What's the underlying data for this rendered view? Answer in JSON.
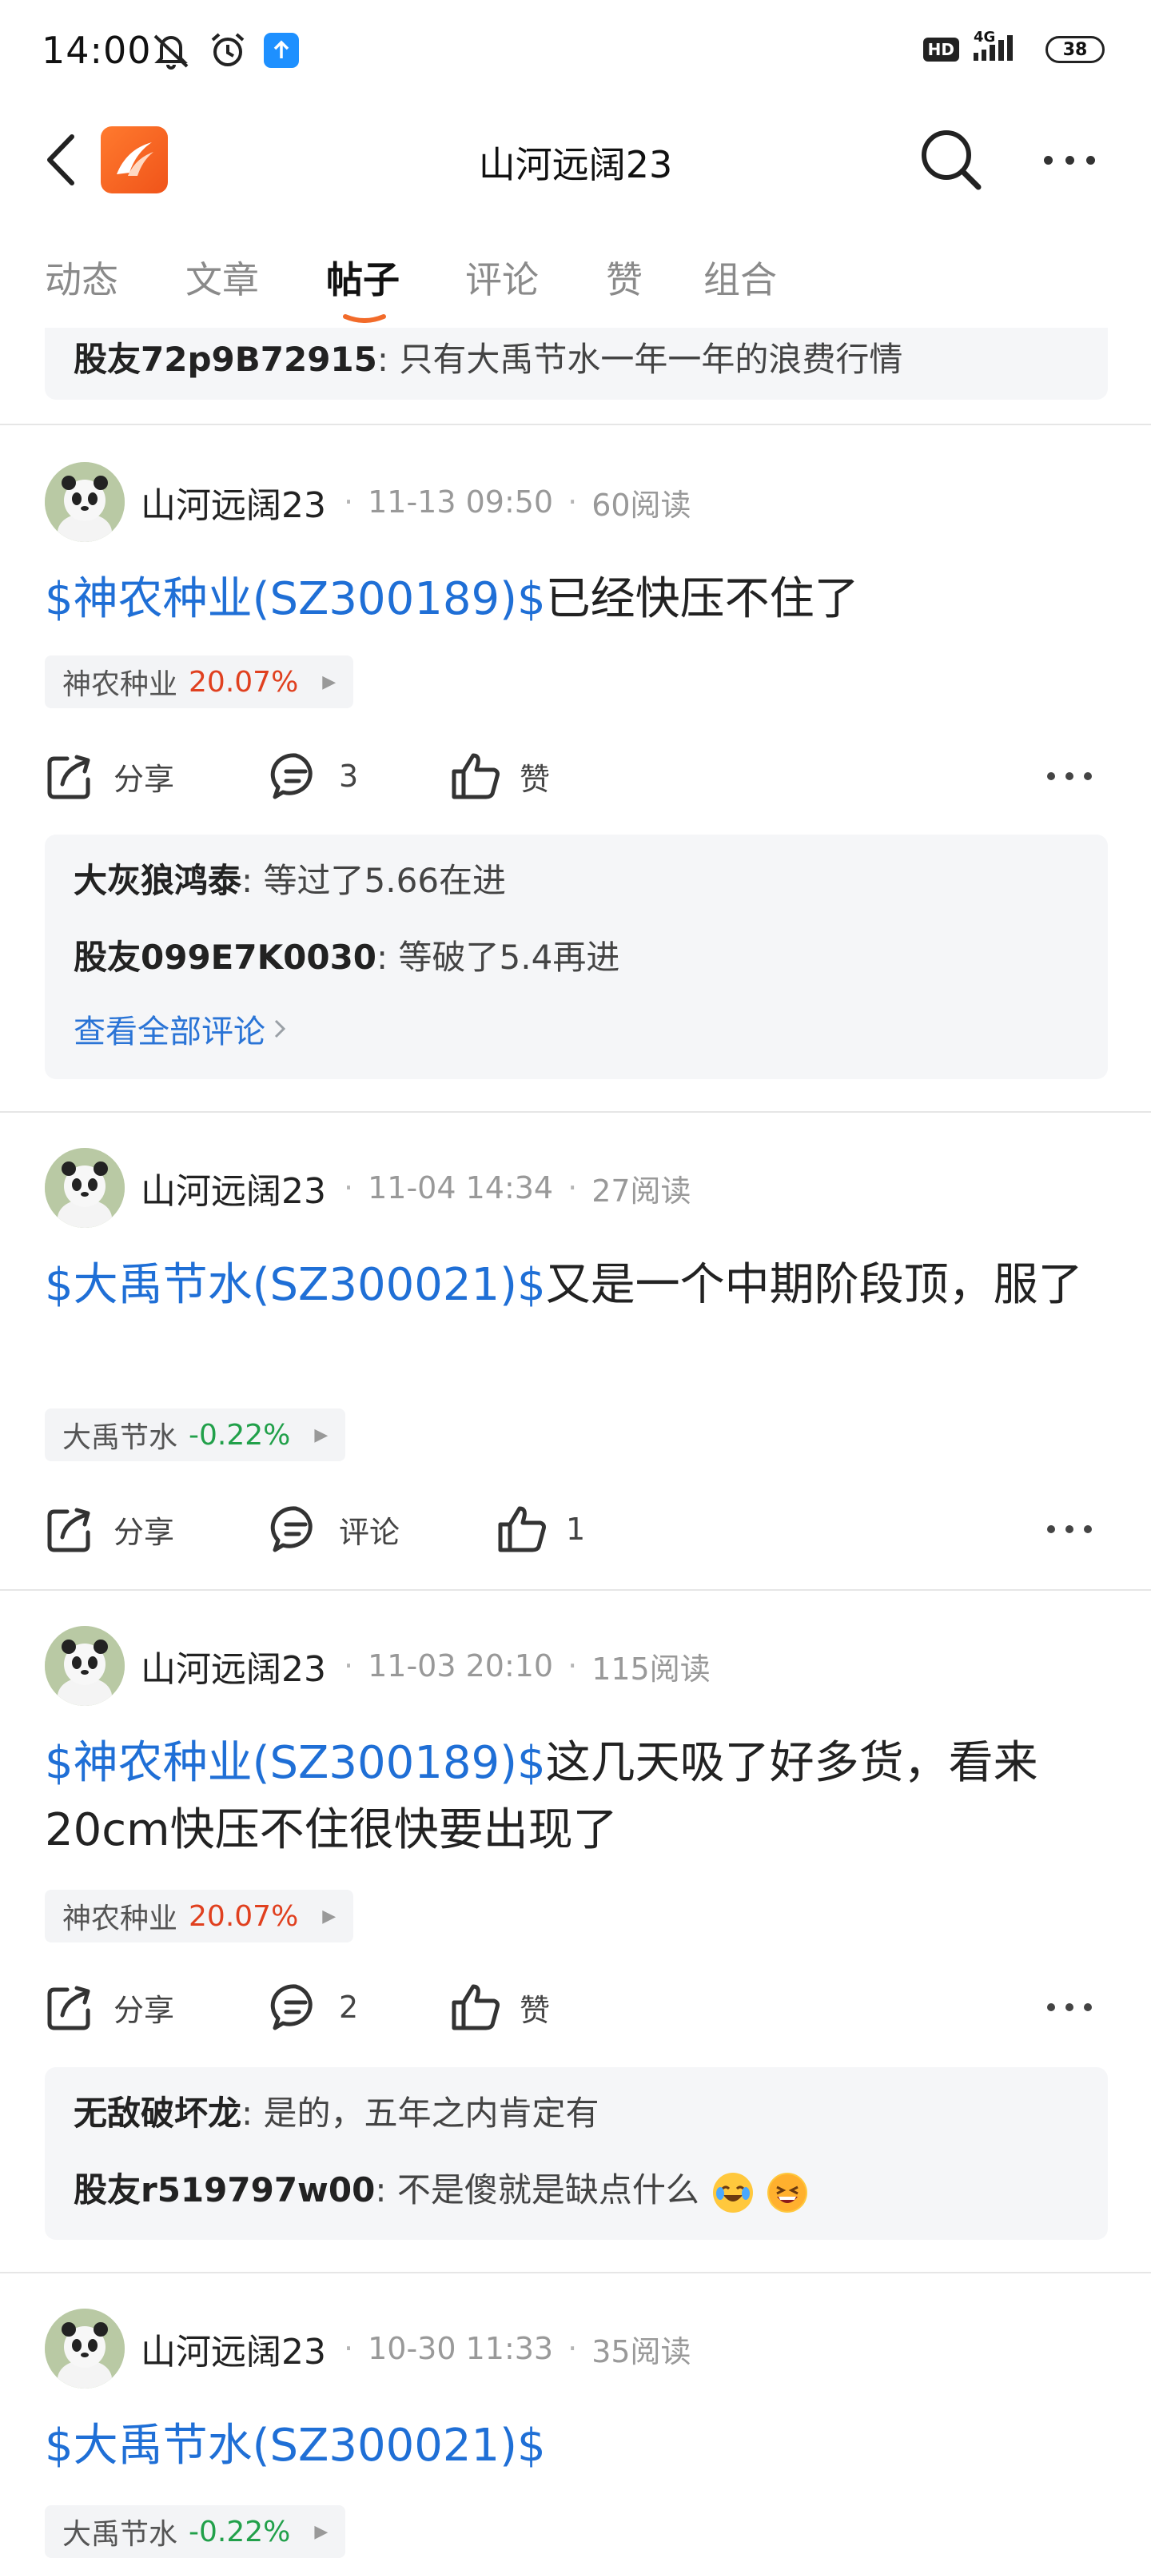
{
  "status_bar": {
    "time": "14:00",
    "network": "4G",
    "hd": "HD",
    "battery": "38"
  },
  "header": {
    "title": "山河远阔23"
  },
  "tabs": [
    {
      "label": "动态",
      "active": false
    },
    {
      "label": "文章",
      "active": false
    },
    {
      "label": "帖子",
      "active": true
    },
    {
      "label": "评论",
      "active": false
    },
    {
      "label": "赞",
      "active": false
    },
    {
      "label": "组合",
      "active": false
    }
  ],
  "partial_comment": {
    "name": "股友72p9B72915",
    "text": "只有大禹节水一年一年的浪费行情"
  },
  "posts": [
    {
      "author": "山河远阔23",
      "time": "11-13 09:50",
      "reads": "60阅读",
      "stock_link": "$神农种业(SZ300189)$",
      "text": "已经快压不住了",
      "chip": {
        "name": "神农种业",
        "change": "20.07%",
        "direction": "up"
      },
      "actions": {
        "share": "分享",
        "comment": "3",
        "like": "赞"
      },
      "comments": [
        {
          "name": "大灰狼鸿泰",
          "text": "等过了5.66在进"
        },
        {
          "name": "股友099E7K0030",
          "text": "等破了5.4再进"
        }
      ],
      "view_all": "查看全部评论"
    },
    {
      "author": "山河远阔23",
      "time": "11-04 14:34",
      "reads": "27阅读",
      "stock_link": "$大禹节水(SZ300021)$",
      "text": "又是一个中期阶段顶，服了",
      "chip": {
        "name": "大禹节水",
        "change": "-0.22%",
        "direction": "down"
      },
      "actions": {
        "share": "分享",
        "comment": "评论",
        "like": "1"
      }
    },
    {
      "author": "山河远阔23",
      "time": "11-03 20:10",
      "reads": "115阅读",
      "stock_link": "$神农种业(SZ300189)$",
      "text": "这几天吸了好多货，看来20cm快压不住很快要出现了",
      "chip": {
        "name": "神农种业",
        "change": "20.07%",
        "direction": "up"
      },
      "actions": {
        "share": "分享",
        "comment": "2",
        "like": "赞"
      },
      "comments": [
        {
          "name": "无敌破坏龙",
          "text": "是的，五年之内肯定有"
        },
        {
          "name": "股友r519797w00",
          "text": "不是傻就是缺点什么"
        }
      ]
    },
    {
      "author": "山河远阔23",
      "time": "10-30 11:33",
      "reads": "35阅读",
      "stock_link": "$大禹节水(SZ300021)$",
      "text": "",
      "chip": {
        "name": "大禹节水",
        "change": "-0.22%",
        "direction": "down"
      }
    }
  ],
  "colors": {
    "link": "#1f6fd6",
    "up": "#e0401f",
    "down": "#21a04a",
    "tab_indicator": "#f26b2a",
    "brand": "#f0541a"
  }
}
